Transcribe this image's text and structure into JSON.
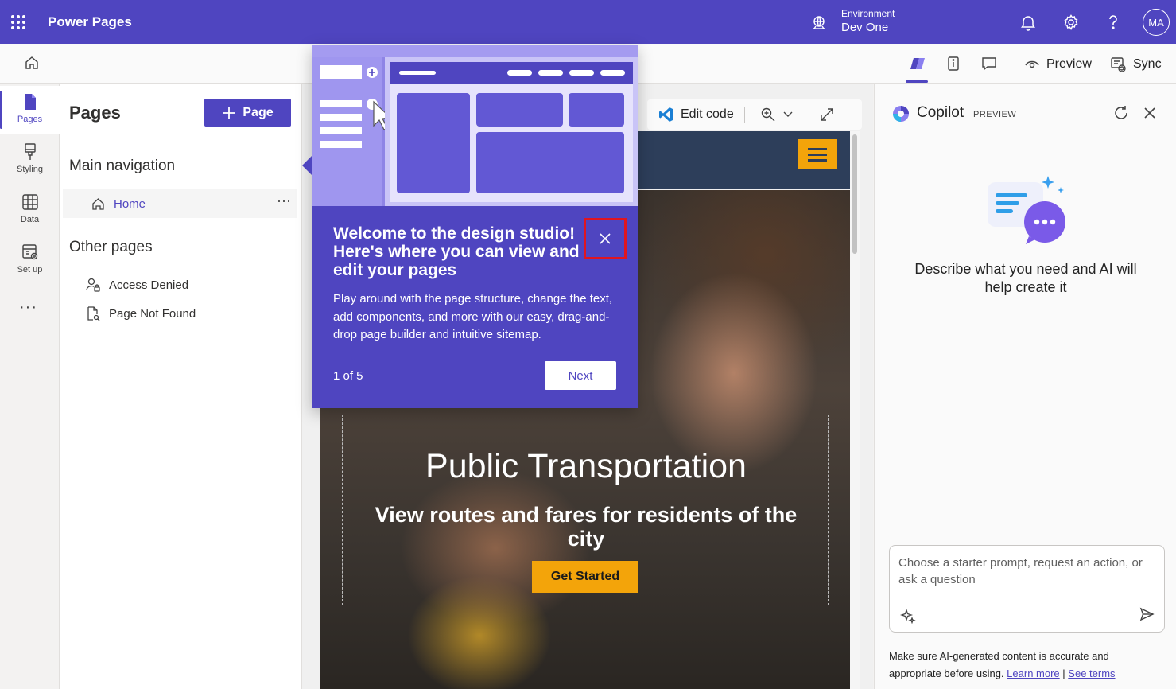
{
  "topbar": {
    "app_name": "Power Pages",
    "environment_label": "Environment",
    "environment_name": "Dev One",
    "avatar_initials": "MA"
  },
  "cmdbar": {
    "preview_label": "Preview",
    "sync_label": "Sync"
  },
  "rail": {
    "items": [
      {
        "label": "Pages",
        "icon": "page-icon"
      },
      {
        "label": "Styling",
        "icon": "paintbrush-icon"
      },
      {
        "label": "Data",
        "icon": "table-icon"
      },
      {
        "label": "Set up",
        "icon": "settings-page-icon"
      }
    ],
    "more": "···"
  },
  "pages_panel": {
    "title": "Pages",
    "add_button": "Page",
    "main_nav_title": "Main navigation",
    "main_nav_items": [
      {
        "label": "Home",
        "more": "···"
      }
    ],
    "other_pages_title": "Other pages",
    "other_pages": [
      {
        "label": "Access Denied",
        "icon": "person-lock-icon"
      },
      {
        "label": "Page Not Found",
        "icon": "page-search-icon"
      }
    ]
  },
  "canvas": {
    "edit_code_label": "Edit code",
    "hero_title": "Public Transportation",
    "hero_subtitle": "View routes and fares for residents of the city",
    "hero_button": "Get Started"
  },
  "popup": {
    "title": "Welcome to the design studio! Here's where you can view and edit your pages",
    "body": "Play around with the page structure, change the text, add components, and more with our easy, drag-and-drop page builder and intuitive sitemap.",
    "counter": "1 of 5",
    "next_label": "Next"
  },
  "copilot": {
    "title": "Copilot",
    "badge": "PREVIEW",
    "description": "Describe what you need and AI will help create it",
    "input_placeholder": "Choose a starter prompt, request an action, or ask a question",
    "disclaimer": "Make sure AI-generated content is accurate and appropriate before using.",
    "learn_more": "Learn more",
    "separator": "|",
    "see_terms": "See terms"
  },
  "colors": {
    "brand": "#4f45c0",
    "accent_orange": "#f3a40a",
    "site_header": "#2d3e5a",
    "highlight_red": "#e0151f"
  }
}
